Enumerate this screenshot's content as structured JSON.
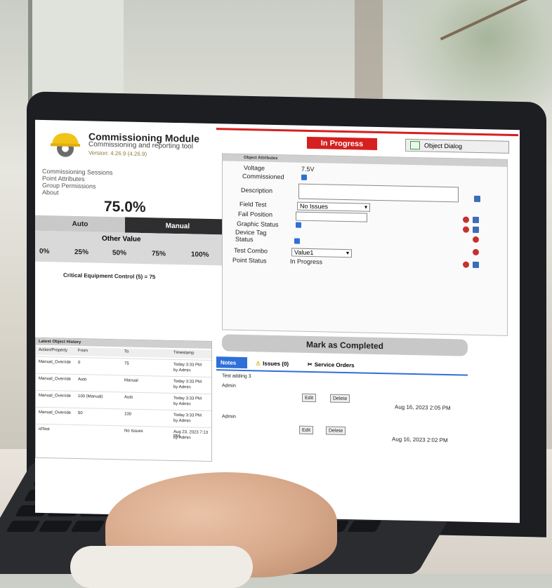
{
  "app": {
    "title": "Commissioning Module",
    "subtitle": "Commissioning and reporting tool",
    "version": "Version: 4.26.9 (4.26.9)"
  },
  "nav": [
    "Commissioning Sessions",
    "Point Attributes",
    "Group Permissions",
    "About"
  ],
  "control": {
    "percent": "75.0%",
    "mode_auto": "Auto",
    "mode_manual": "Manual",
    "other_value": "Other Value",
    "ticks": [
      "0%",
      "25%",
      "50%",
      "75%",
      "100%"
    ],
    "critical": "Critical Equipment Control (5) = 75"
  },
  "status_button": "In Progress",
  "object_dialog": "Object Dialog",
  "attributes": {
    "header": "Object Attributes",
    "voltage_label": "Voltage",
    "voltage_value": "7.5V",
    "commissioned_label": "Commissioned",
    "description_label": "Description",
    "field_test_label": "Field Test",
    "field_test_value": "No Issues",
    "fail_position_label": "Fail Position",
    "graphic_status_label": "Graphic Status",
    "device_tag_label": "Device Tag",
    "device_tag_label2": "Status",
    "test_combo_label": "Test Combo",
    "test_combo_value": "Value1",
    "point_status_label": "Point Status",
    "point_status_value": "In Progress"
  },
  "mark_completed": "Mark as Completed",
  "tabs": {
    "notes": "Notes",
    "issues": "Issues (0)",
    "service_orders": "Service Orders"
  },
  "notes": {
    "first_note": "Test adding 3",
    "items": [
      {
        "user": "Admin",
        "edit": "Edit",
        "delete": "Delete",
        "date": "Aug 16, 2023 2:05 PM"
      },
      {
        "user": "Admin",
        "edit": "Edit",
        "delete": "Delete",
        "date": "Aug 16, 2023 2:02 PM"
      }
    ]
  },
  "history": {
    "header": "Latest Object History",
    "columns": [
      "Action/Property",
      "From",
      "To",
      "Timestamp"
    ],
    "rows": [
      {
        "action": "Manual_Override",
        "from": "0",
        "to": "75",
        "ts": "Today 3:33 PM",
        "by": "by Admin"
      },
      {
        "action": "Manual_Override",
        "from": "Auto",
        "to": "Manual",
        "ts": "Today 3:33 PM",
        "by": "by Admin"
      },
      {
        "action": "Manual_Override",
        "from": "100 (Manual)",
        "to": "Auto",
        "ts": "Today 3:33 PM",
        "by": "by Admin"
      },
      {
        "action": "Manual_Override",
        "from": "50",
        "to": "100",
        "ts": "Today 3:33 PM",
        "by": "by Admin"
      },
      {
        "action": "idTest",
        "from": "",
        "to": "No Issues",
        "ts": "Aug 23, 2023 7:13 PM",
        "by": "by Admin"
      }
    ]
  },
  "colors": {
    "accent_red": "#d61f1f",
    "accent_blue": "#2f6fd8",
    "dark": "#2e2e30"
  }
}
